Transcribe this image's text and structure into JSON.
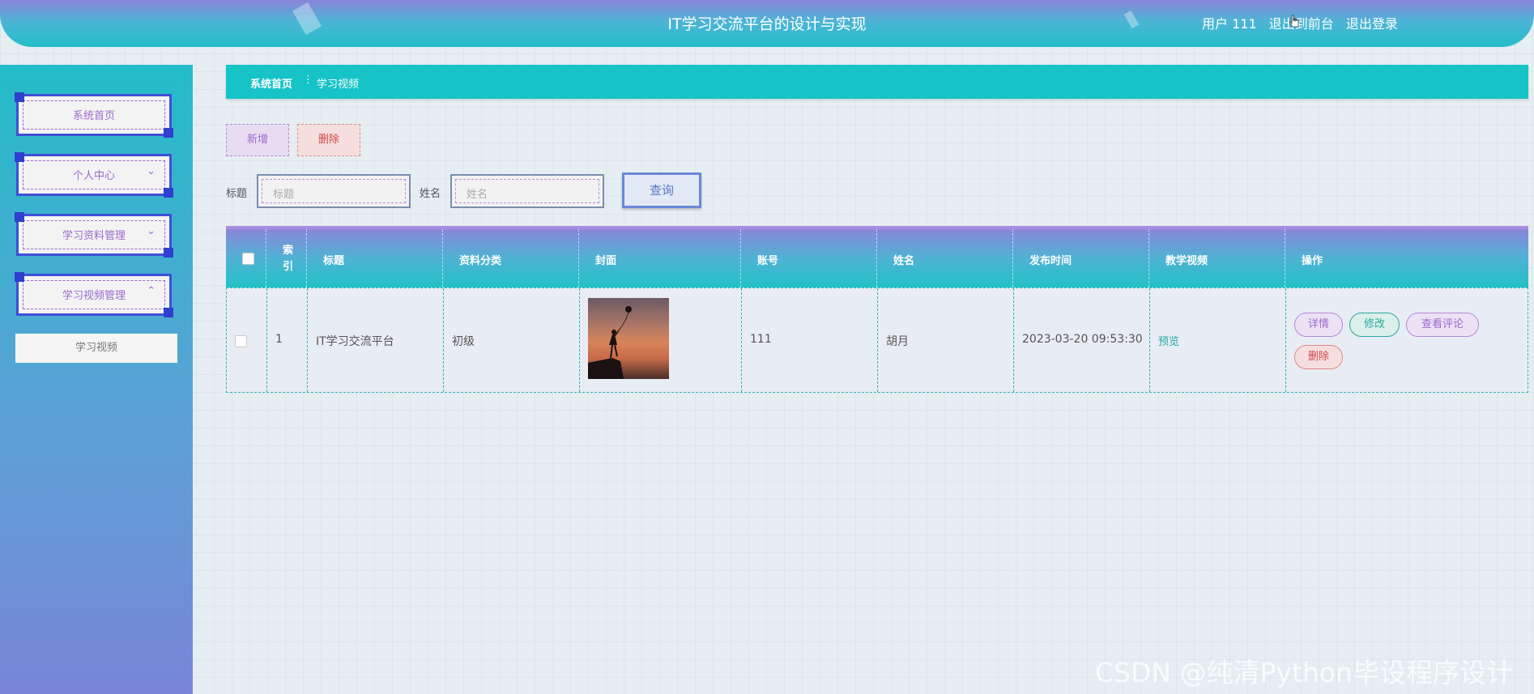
{
  "header": {
    "title": "IT学习交流平台的设计与实现",
    "user": "用户 111",
    "exit_front": "退出到前台",
    "logout": "退出登录"
  },
  "sidebar": {
    "items": [
      {
        "label": "系统首页"
      },
      {
        "label": "个人中心",
        "chevron": "chevron-down"
      },
      {
        "label": "学习资料管理",
        "chevron": "chevron-down"
      },
      {
        "label": "学习视频管理",
        "chevron": "chevron-up"
      }
    ],
    "submenu": "学习视频"
  },
  "breadcrumb": {
    "home": "系统首页",
    "current": "学习视频"
  },
  "toolbar": {
    "add_label": "新增",
    "delete_label": "删除"
  },
  "search": {
    "title_label": "标题",
    "title_placeholder": "标题",
    "name_label": "姓名",
    "name_placeholder": "姓名",
    "query_label": "查询"
  },
  "table": {
    "headers": {
      "index": "索引",
      "title": "标题",
      "category": "资料分类",
      "cover": "封面",
      "account": "账号",
      "name": "姓名",
      "publish_time": "发布时间",
      "video": "教学视频",
      "actions": "操作"
    },
    "rows": [
      {
        "index": "1",
        "title": "IT学习交流平台",
        "category": "初级",
        "cover": "cover-image",
        "account": "111",
        "name": "胡月",
        "publish_time": "2023-03-20 09:53:30",
        "video": "预览",
        "actions": {
          "detail": "详情",
          "edit": "修改",
          "comments": "查看评论",
          "delete": "删除"
        }
      }
    ]
  },
  "watermark": "CSDN @纯清Python毕设程序设计",
  "colors": {
    "teal": "#16c3c7",
    "purple": "#9a6ad0",
    "danger": "#d04848",
    "link_green": "#2aa8a0"
  }
}
